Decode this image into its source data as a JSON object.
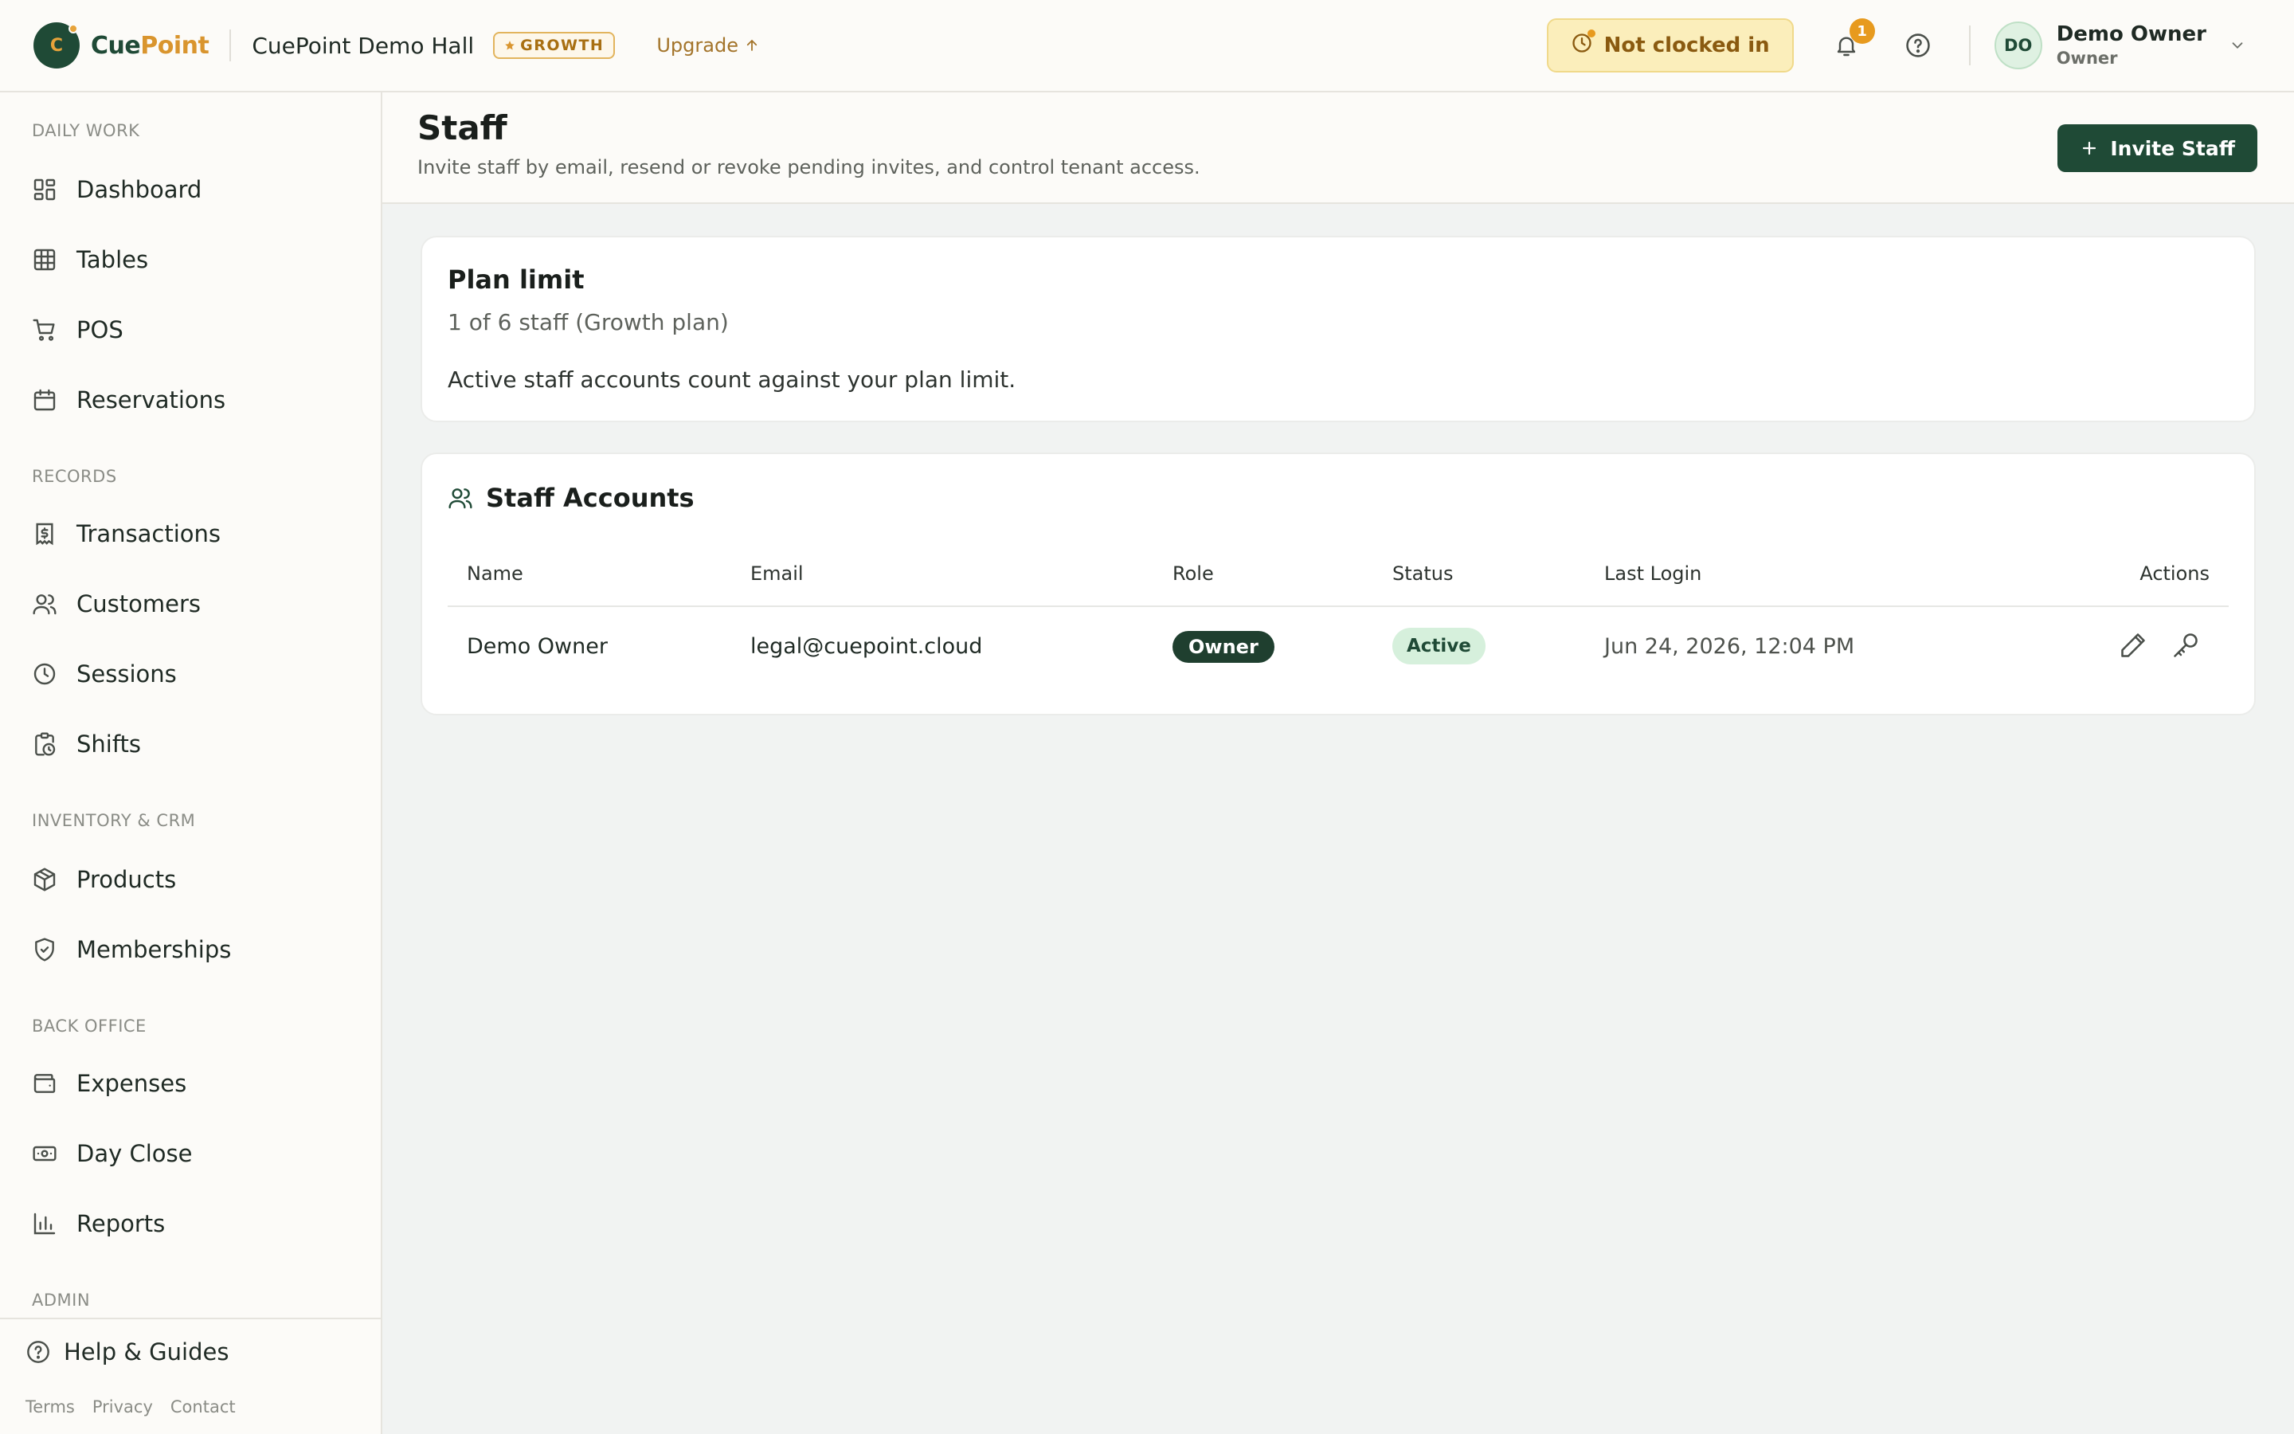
{
  "brand": {
    "logo_letter": "C",
    "name_part1": "Cue",
    "name_part2": "Point"
  },
  "topbar": {
    "venue": "CuePoint Demo Hall",
    "plan_badge": "GROWTH",
    "upgrade": "Upgrade",
    "clock_status": "Not clocked in",
    "notifications_count": "1",
    "user": {
      "initials": "DO",
      "name": "Demo Owner",
      "role": "Owner"
    }
  },
  "sidebar": {
    "sections": {
      "daily_work": "DAILY WORK",
      "records": "RECORDS",
      "inventory": "INVENTORY & CRM",
      "back_office": "BACK OFFICE",
      "admin": "ADMIN"
    },
    "items": {
      "dashboard": "Dashboard",
      "tables": "Tables",
      "pos": "POS",
      "reservations": "Reservations",
      "transactions": "Transactions",
      "customers": "Customers",
      "sessions": "Sessions",
      "shifts": "Shifts",
      "products": "Products",
      "memberships": "Memberships",
      "expenses": "Expenses",
      "day_close": "Day Close",
      "reports": "Reports"
    },
    "footer": {
      "help": "Help & Guides",
      "terms": "Terms",
      "privacy": "Privacy",
      "contact": "Contact"
    }
  },
  "page": {
    "title": "Staff",
    "subtitle": "Invite staff by email, resend or revoke pending invites, and control tenant access.",
    "invite_button": "Invite Staff"
  },
  "plan_limit": {
    "title": "Plan limit",
    "count": "1 of 6 staff (Growth plan)",
    "note": "Active staff accounts count against your plan limit."
  },
  "staff_accounts": {
    "title": "Staff Accounts",
    "columns": {
      "name": "Name",
      "email": "Email",
      "role": "Role",
      "status": "Status",
      "last_login": "Last Login",
      "actions": "Actions"
    },
    "rows": [
      {
        "name": "Demo Owner",
        "email": "legal@cuepoint.cloud",
        "role": "Owner",
        "status": "Active",
        "last_login": "Jun 24, 2026, 12:04 PM"
      }
    ]
  },
  "colors": {
    "brand_green": "#1f4a36",
    "accent_gold": "#d9952e",
    "active_bg": "#d6f0dc",
    "clock_bg": "#fbeebb"
  }
}
